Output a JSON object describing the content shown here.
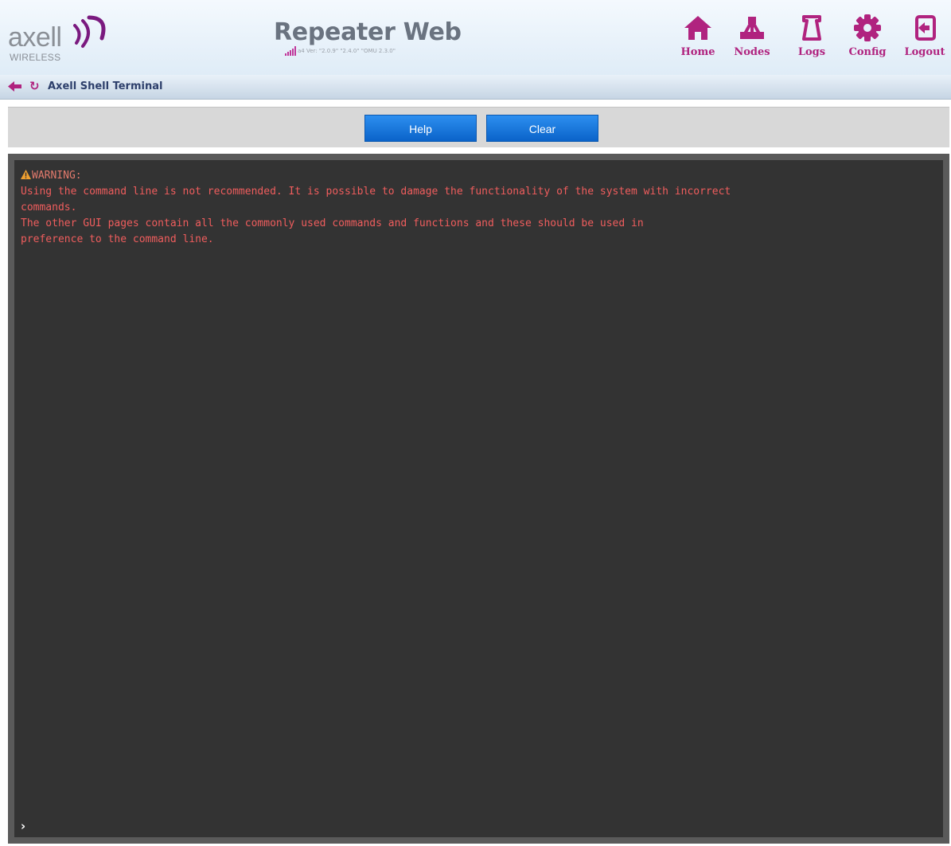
{
  "header": {
    "logo_word": "axell",
    "logo_sub": "WIRELESS",
    "app_title": "Repeater Web",
    "version_text": "a4 Ver: \"2.0.9\" \"2.4.0\" \"OMU 2.3.0\"",
    "nav": [
      {
        "label": "Home",
        "icon": "home-icon"
      },
      {
        "label": "Nodes",
        "icon": "nodes-icon"
      },
      {
        "label": "Logs",
        "icon": "logs-icon"
      },
      {
        "label": "Config",
        "icon": "gear-icon"
      },
      {
        "label": "Logout",
        "icon": "logout-icon"
      }
    ]
  },
  "breadcrumb": {
    "title": "Axell Shell Terminal"
  },
  "toolbar": {
    "help_label": "Help",
    "clear_label": "Clear"
  },
  "terminal": {
    "warning_label": "WARNING:",
    "lines": [
      "Using the command line is not recommended. It is possible to damage the functionality of the system with incorrect",
      "commands.",
      "The other GUI pages contain all the commonly used commands and functions and these should be used in",
      "preference to the command line."
    ],
    "prompt": "›",
    "input_value": ""
  },
  "colors": {
    "accent": "#b0237f",
    "button": "#0a63c9",
    "terminal_bg": "#333333",
    "terminal_text": "#ef5d5d"
  }
}
